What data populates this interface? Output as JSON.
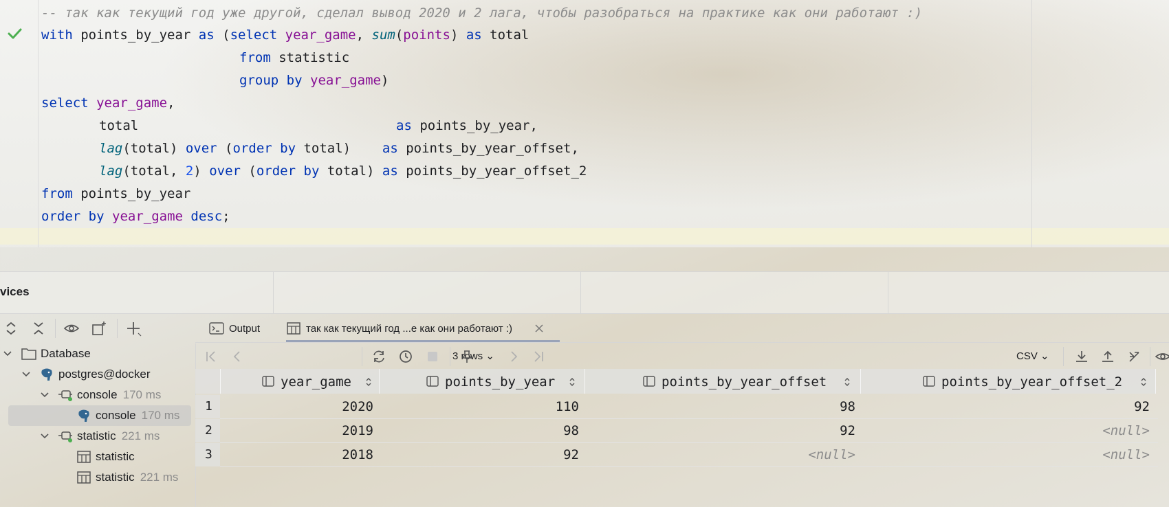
{
  "editor": {
    "comment": "-- так как текущий год уже другой, сделал вывод 2020 и 2 лага, чтобы разобраться на практике как они работают :)",
    "l1": {
      "kw1": "with",
      "t1": " points_by_year ",
      "kw2": "as",
      "t2": " (",
      "kw3": "select",
      "t3": " ",
      "c1": "year_game",
      "t4": ", ",
      "f1": "sum",
      "t5": "(",
      "c2": "points",
      "t6": ") ",
      "kw4": "as",
      "t7": " total"
    },
    "l2": {
      "kw": "from",
      "t": " statistic"
    },
    "l3": {
      "kw1": "group",
      "t1": " ",
      "kw2": "by",
      "t2": " ",
      "c": "year_game",
      "t3": ")"
    },
    "l4": {
      "kw": "select",
      "t1": " ",
      "c": "year_game",
      "t2": ","
    },
    "l5": {
      "t1": "total",
      "kw": "as",
      "t2": " points_by_year,"
    },
    "l6": {
      "f": "lag",
      "t1": "(total) ",
      "kw1": "over",
      "t2": " (",
      "kw2": "order",
      "t3": " ",
      "kw3": "by",
      "t4": " total)    ",
      "kw4": "as",
      "t5": " points_by_year_offset,"
    },
    "l7": {
      "f": "lag",
      "t1": "(total, ",
      "n": "2",
      "t2": ") ",
      "kw1": "over",
      "t3": " (",
      "kw2": "order",
      "t4": " ",
      "kw3": "by",
      "t5": " total) ",
      "kw4": "as",
      "t6": " points_by_year_offset_2"
    },
    "l8": {
      "kw": "from",
      "t": " points_by_year"
    },
    "l9": {
      "kw1": "order",
      "t1": " ",
      "kw2": "by",
      "t2": " ",
      "c": "year_game",
      "t3": " ",
      "kw3": "desc",
      "t4": ";"
    }
  },
  "panel": {
    "title": "vices"
  },
  "tree": {
    "database": "Database",
    "connection": "postgres@docker",
    "console_group": "console",
    "console_group_time": "170 ms",
    "console_item": "console",
    "console_item_time": "170 ms",
    "statistic_group": "statistic",
    "statistic_group_time": "221 ms",
    "statistic_item1": "statistic",
    "statistic_item2": "statistic",
    "statistic_item2_time": "221 ms"
  },
  "tabs": {
    "output": "Output",
    "result": "так как текущий год ...е как они работают :)"
  },
  "result_toolbar": {
    "rows": "3 rows",
    "format": "CSV"
  },
  "grid": {
    "columns": [
      "year_game",
      "points_by_year",
      "points_by_year_offset",
      "points_by_year_offset_2"
    ],
    "rows": [
      {
        "n": "1",
        "year_game": "2020",
        "points_by_year": "110",
        "offset": "98",
        "offset_2": "92"
      },
      {
        "n": "2",
        "year_game": "2019",
        "points_by_year": "98",
        "offset": "92",
        "offset_2": "<null>"
      },
      {
        "n": "3",
        "year_game": "2018",
        "points_by_year": "92",
        "offset": "<null>",
        "offset_2": "<null>"
      }
    ]
  },
  "colors": {
    "keyword": "#0033b3",
    "column": "#871094",
    "function": "#00627a",
    "number": "#1750eb",
    "comment": "#8c8c8c",
    "success": "#4caf50"
  }
}
